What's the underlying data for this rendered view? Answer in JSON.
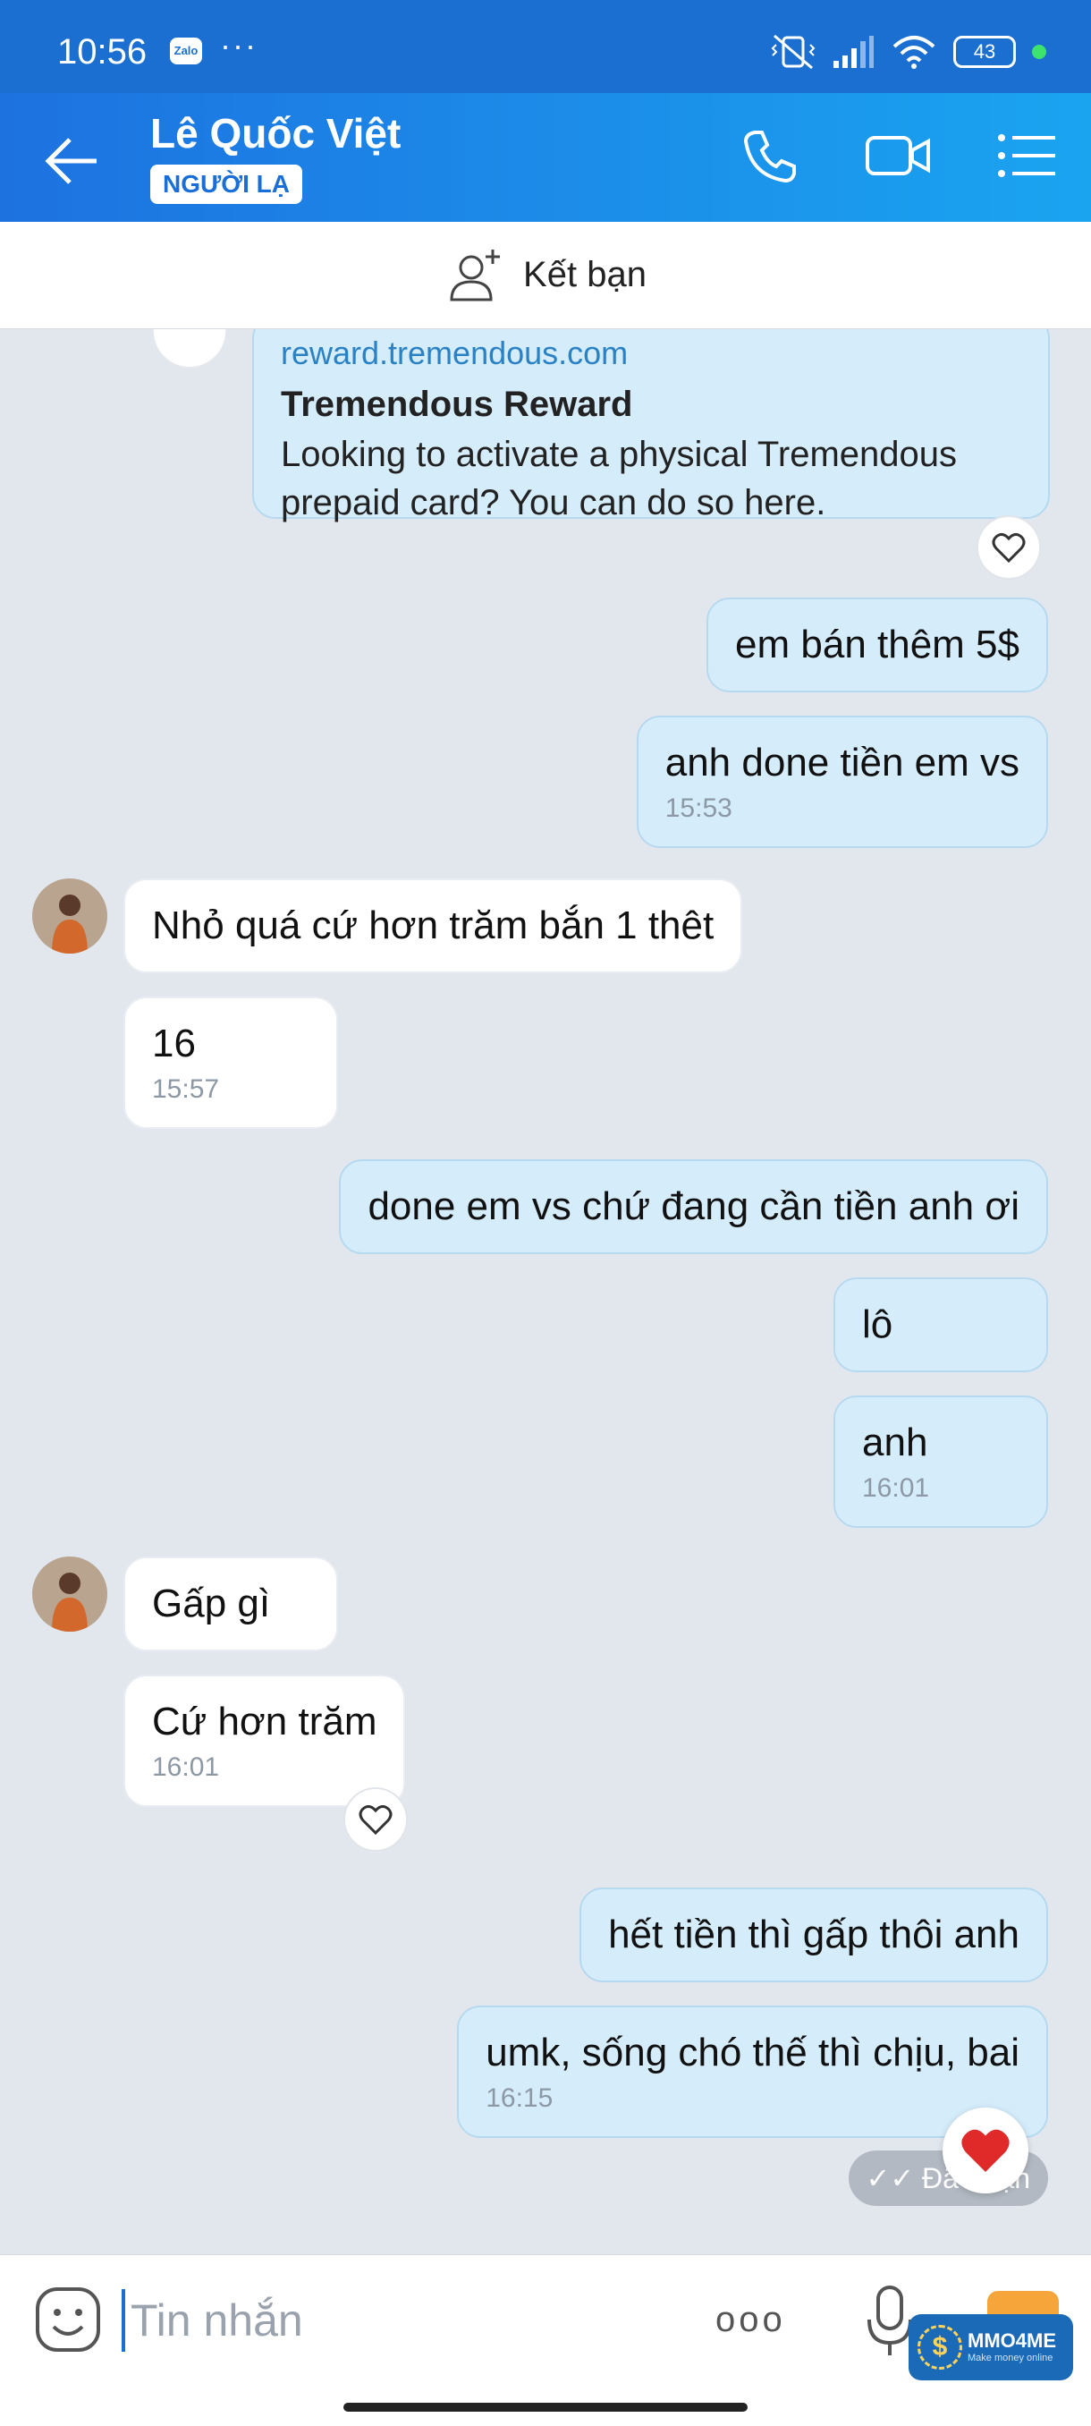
{
  "status_bar": {
    "time": "10:56",
    "app_badge": "Zalo",
    "dots": "···",
    "battery": "43"
  },
  "header": {
    "contact_name": "Lê Quốc Việt",
    "badge": "NGƯỜI LẠ"
  },
  "add_friend": {
    "label": "Kết bạn"
  },
  "link_card": {
    "url": "reward.tremendous.com",
    "title": "Tremendous Reward",
    "description": "Looking to activate a physical Tremendous prepaid card? You can do so here."
  },
  "messages": [
    {
      "sender": "me",
      "text": "em bán thêm 5$"
    },
    {
      "sender": "me",
      "text": "anh done tiền em vs",
      "time": "15:53"
    },
    {
      "sender": "them",
      "text": "Nhỏ quá cứ hơn trăm bắn 1 thêt"
    },
    {
      "sender": "them",
      "text": "16",
      "time": "15:57"
    },
    {
      "sender": "me",
      "text": "done em vs chứ đang cần tiền anh ơi"
    },
    {
      "sender": "me",
      "text": "lô"
    },
    {
      "sender": "me",
      "text": "anh",
      "time": "16:01"
    },
    {
      "sender": "them",
      "text": "Gấp gì"
    },
    {
      "sender": "them",
      "text": "Cứ hơn trăm",
      "time": "16:01"
    },
    {
      "sender": "me",
      "text": "hết tiền thì gấp thôi anh"
    },
    {
      "sender": "me",
      "text": "umk, sống chó thế thì chịu, bai",
      "time": "16:15"
    }
  ],
  "seen_status": "Đã nhận",
  "input": {
    "placeholder": "Tin nhắn",
    "more": "ooo"
  },
  "watermark": {
    "title": "MMO4ME",
    "subtitle": "Make money online"
  },
  "colors": {
    "header": "#1b6fd1",
    "my_bubble": "#d5ecfb",
    "their_bubble": "#ffffff",
    "background": "#e2e7ee"
  }
}
